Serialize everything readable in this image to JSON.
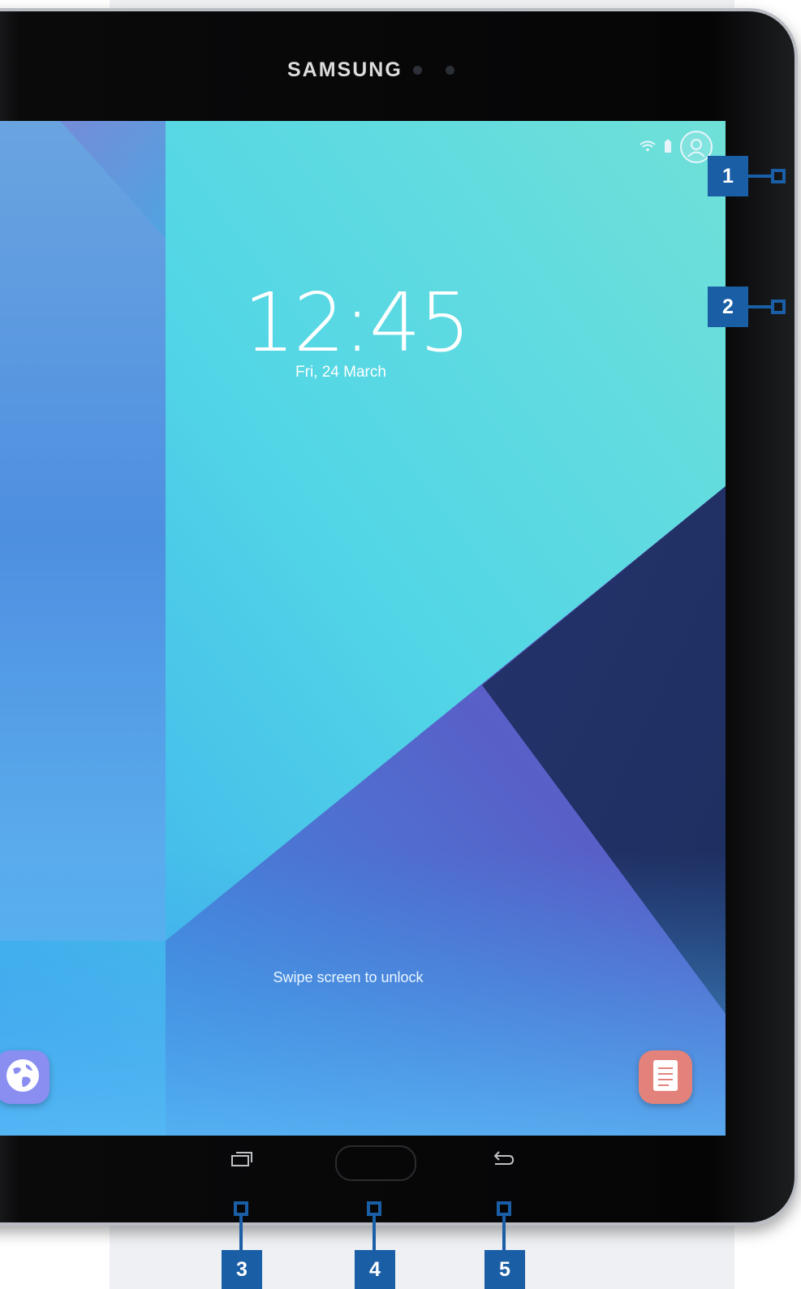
{
  "device": {
    "brand": "SAMSUNG"
  },
  "lockscreen": {
    "time": "12:45",
    "date": "Fri, 24 March",
    "unlock_hint": "Swipe screen to unlock"
  },
  "shortcuts": {
    "left": "globe-icon",
    "right": "notes-icon"
  },
  "callouts": [
    "1",
    "2",
    "3",
    "4",
    "5"
  ],
  "colors": {
    "callout": "#1a5ea6",
    "bezel": "#050506"
  }
}
